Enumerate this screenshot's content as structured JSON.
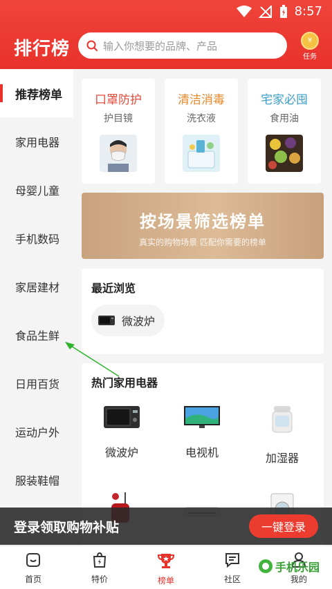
{
  "status_bar": {
    "time": "8:57"
  },
  "header": {
    "title": "排行榜",
    "search_placeholder": "输入你想要的品牌、产品",
    "task_label": "任务",
    "task_coin": "¥"
  },
  "sidebar": {
    "items": [
      {
        "label": "推荐榜单"
      },
      {
        "label": "家用电器"
      },
      {
        "label": "母婴儿童"
      },
      {
        "label": "手机数码"
      },
      {
        "label": "家居建材"
      },
      {
        "label": "食品生鲜"
      },
      {
        "label": "日用百货"
      },
      {
        "label": "运动户外"
      },
      {
        "label": "服装鞋帽"
      }
    ]
  },
  "featured": [
    {
      "title": "口罩防护",
      "sub": "护目镜",
      "color": "#e24a3a"
    },
    {
      "title": "清洁消毒",
      "sub": "洗衣液",
      "color": "#e8892b"
    },
    {
      "title": "宅家必囤",
      "sub": "食用油",
      "color": "#3a9fc6"
    }
  ],
  "banner": {
    "title": "按场景筛选榜单",
    "subtitle": "真实的购物场景 匹配你需要的榜单"
  },
  "recent": {
    "title": "最近浏览",
    "items": [
      {
        "label": "微波炉"
      }
    ]
  },
  "hot": {
    "title": "热门家用电器",
    "items": [
      {
        "label": "微波炉"
      },
      {
        "label": "电视机"
      },
      {
        "label": "加湿器"
      }
    ]
  },
  "login_bar": {
    "text": "登录领取购物补贴",
    "button": "一键登录"
  },
  "tabbar": {
    "tabs": [
      {
        "label": "首页"
      },
      {
        "label": "特价"
      },
      {
        "label": "榜单"
      },
      {
        "label": "社区"
      },
      {
        "label": "我的"
      }
    ]
  },
  "watermark": {
    "text": "手机乐园"
  },
  "colors": {
    "brand": "#e8322b",
    "banner": "#d2ae89"
  }
}
